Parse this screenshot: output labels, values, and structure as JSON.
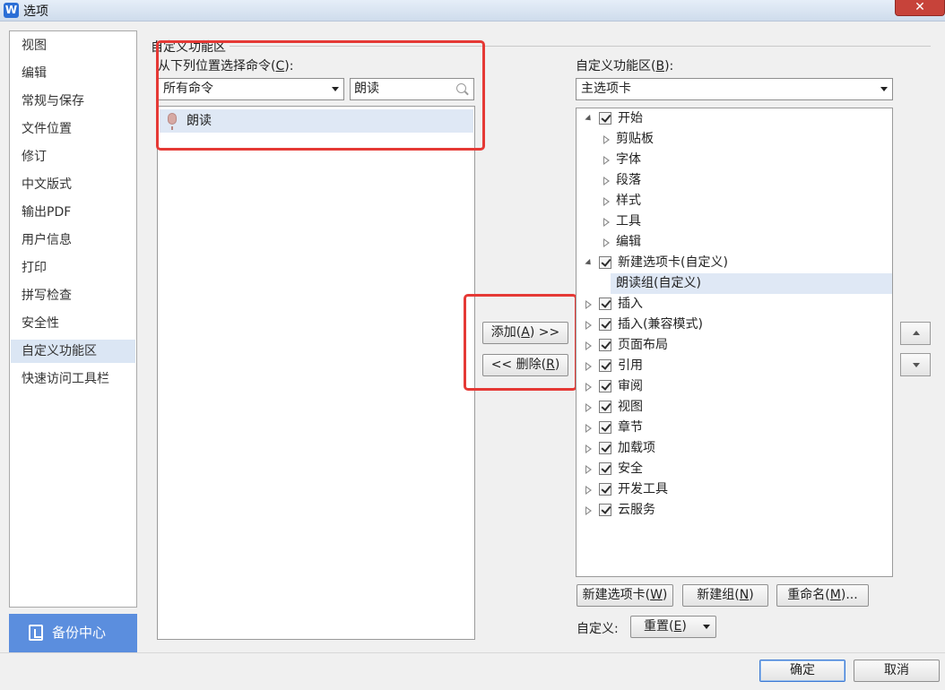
{
  "window": {
    "title": "选项",
    "app_icon": "W",
    "close_symbol": "✕"
  },
  "nav": {
    "items": [
      "视图",
      "编辑",
      "常规与保存",
      "文件位置",
      "修订",
      "中文版式",
      "输出PDF",
      "用户信息",
      "打印",
      "拼写检查",
      "安全性",
      "自定义功能区",
      "快速访问工具栏"
    ],
    "selected": "自定义功能区",
    "backup_label": "备份中心"
  },
  "section": {
    "title": "自定义功能区"
  },
  "left": {
    "choose_label": "从下列位置选择命令",
    "choose_key": "C",
    "source_value": "所有命令",
    "search_value": "朗读",
    "commands": [
      "朗读"
    ]
  },
  "middle": {
    "add_label": "添加",
    "add_key": "A",
    "add_suffix": ">>",
    "remove_prefix": "<<",
    "remove_label": "删除",
    "remove_key": "R"
  },
  "right": {
    "ribbon_label": "自定义功能区",
    "ribbon_key": "B",
    "ribbon_value": "主选项卡",
    "tree": [
      {
        "label": "开始",
        "checked": true,
        "expanded": true
      },
      {
        "label": "剪贴板",
        "child": true
      },
      {
        "label": "字体",
        "child": true
      },
      {
        "label": "段落",
        "child": true
      },
      {
        "label": "样式",
        "child": true
      },
      {
        "label": "工具",
        "child": true
      },
      {
        "label": "编辑",
        "child": true
      },
      {
        "label": "新建选项卡(自定义)",
        "checked": true,
        "expanded": true
      },
      {
        "label": "朗读组(自定义)",
        "child": true,
        "leaf": true,
        "selected": true
      },
      {
        "label": "插入",
        "checked": true
      },
      {
        "label": "插入(兼容模式)",
        "checked": true
      },
      {
        "label": "页面布局",
        "checked": true
      },
      {
        "label": "引用",
        "checked": true
      },
      {
        "label": "审阅",
        "checked": true
      },
      {
        "label": "视图",
        "checked": true
      },
      {
        "label": "章节",
        "checked": true
      },
      {
        "label": "加载项",
        "checked": true
      },
      {
        "label": "安全",
        "checked": true
      },
      {
        "label": "开发工具",
        "checked": true
      },
      {
        "label": "云服务",
        "checked": true
      }
    ],
    "new_tab_label": "新建选项卡",
    "new_tab_key": "W",
    "new_group_label": "新建组",
    "new_group_key": "N",
    "rename_label": "重命名",
    "rename_key": "M",
    "rename_suffix": "...",
    "customize_label": "自定义:",
    "reset_label": "重置",
    "reset_key": "E"
  },
  "footer": {
    "ok_label": "确定",
    "cancel_label": "取消"
  },
  "colors": {
    "accent": "#5b8ede",
    "highlight_red": "#e53935",
    "selection": "#dfe8f5"
  }
}
